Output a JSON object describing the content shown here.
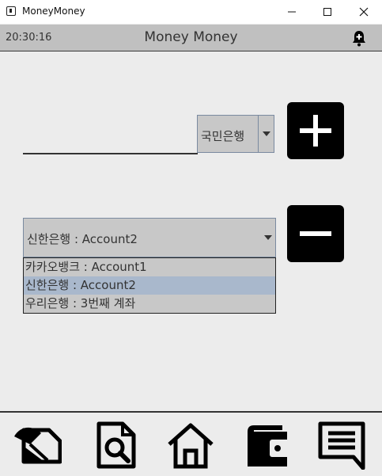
{
  "window": {
    "title": "MoneyMoney",
    "icons": [
      "app-icon",
      "minimize-icon",
      "maximize-icon",
      "close-icon"
    ]
  },
  "header": {
    "clock": "20:30:16",
    "title": "Money Money",
    "icon": "bell-plus-icon"
  },
  "add_section": {
    "amount_value": "",
    "bank_selected": "국민은행",
    "add_icon": "plus-icon"
  },
  "remove_section": {
    "account_selected": "신한은행 : Account2",
    "remove_icon": "minus-icon",
    "options": [
      "카카오뱅크 : Account1",
      "신한은행 : Account2",
      "우리은행 : 3번째 계좌"
    ],
    "selected_index": 1
  },
  "bottom_nav": {
    "items": [
      "edit-note-icon",
      "search-document-icon",
      "home-icon",
      "wallet-icon",
      "chat-icon"
    ]
  },
  "colors": {
    "header_bg": "#c0c0c0",
    "page_bg": "#ececec",
    "combo_bg": "#c8c8c8",
    "selection": "#a9b8cc",
    "button_bg": "#000000"
  }
}
